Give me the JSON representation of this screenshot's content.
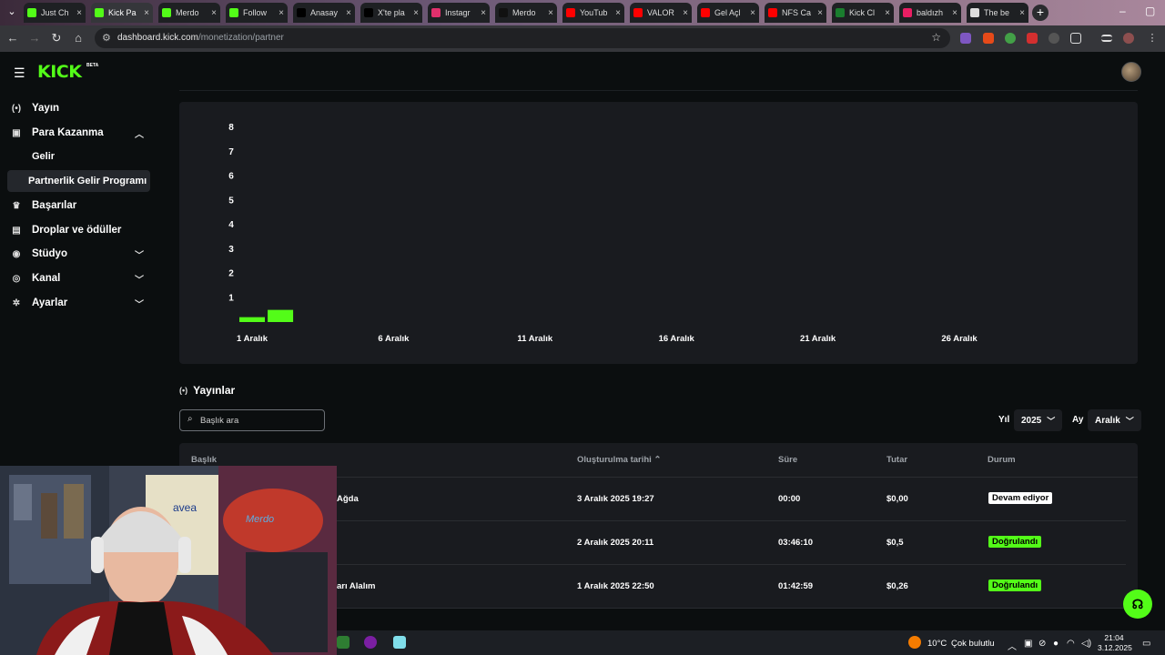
{
  "browser": {
    "tabs": [
      {
        "title": "Just Ch",
        "color": "#53fc18"
      },
      {
        "title": "Kick Pa",
        "color": "#53fc18",
        "active": true
      },
      {
        "title": "Merdo",
        "color": "#53fc18"
      },
      {
        "title": "Follow",
        "color": "#53fc18"
      },
      {
        "title": "Anasay",
        "color": "#000000"
      },
      {
        "title": "X'te pla",
        "color": "#000000"
      },
      {
        "title": "Instagr",
        "color": "#e1306c"
      },
      {
        "title": "Merdo",
        "color": "#111111"
      },
      {
        "title": "YouTub",
        "color": "#ff0000"
      },
      {
        "title": "VALOR",
        "color": "#ff0000"
      },
      {
        "title": "Gel Açl",
        "color": "#ff0000"
      },
      {
        "title": "NFS Ca",
        "color": "#ff0000"
      },
      {
        "title": "Kick Cl",
        "color": "#1a7d2e"
      },
      {
        "title": "baldızh",
        "color": "#e91e63"
      },
      {
        "title": "The be",
        "color": "#dddddd"
      }
    ],
    "url_host": "dashboard.kick.com",
    "url_path": "/monetization/partner"
  },
  "app": {
    "logo": "KICK",
    "logo_badge": "BETA"
  },
  "sidebar": {
    "items": [
      {
        "label": "Yayın",
        "icon": "broadcast-icon"
      },
      {
        "label": "Para Kazanma",
        "icon": "money-icon",
        "expanded": true
      },
      {
        "label": "Gelir",
        "sub": true
      },
      {
        "label": "Partnerlik Gelir Programı",
        "sub": true,
        "active": true
      },
      {
        "label": "Başarılar",
        "icon": "trophy-icon"
      },
      {
        "label": "Droplar ve ödüller",
        "icon": "gift-icon"
      },
      {
        "label": "Stüdyo",
        "icon": "studio-icon",
        "collapsible": true
      },
      {
        "label": "Kanal",
        "icon": "channel-icon",
        "collapsible": true
      },
      {
        "label": "Ayarlar",
        "icon": "gear-icon",
        "collapsible": true
      }
    ]
  },
  "chart_data": {
    "type": "bar",
    "categories": [
      "1 Aralık",
      "2 Aralık"
    ],
    "values": [
      0.2,
      0.5
    ],
    "x_ticks": [
      "1 Aralık",
      "6 Aralık",
      "11 Aralık",
      "16 Aralık",
      "21 Aralık",
      "26 Aralık"
    ],
    "y_ticks": [
      1,
      2,
      3,
      4,
      5,
      6,
      7,
      8
    ],
    "ylim": [
      0,
      8
    ],
    "bar_color": "#53fc18",
    "grid": false
  },
  "streams": {
    "title": "Yayınlar",
    "search_placeholder": "Başlık ara",
    "year_label": "Yıl",
    "year_value": "2025",
    "month_label": "Ay",
    "month_value": "Aralık",
    "columns": [
      "Başlık",
      "Oluşturulma tarihi",
      "Süre",
      "Tutar",
      "Durum"
    ],
    "rows": [
      {
        "title": "Ağda",
        "date": "3 Aralık 2025 19:27",
        "duration": "00:00",
        "amount": "$0,00",
        "status": "Devam ediyor",
        "status_kind": "live"
      },
      {
        "title": "",
        "date": "2 Aralık 2025 20:11",
        "duration": "03:46:10",
        "amount": "$0,5",
        "status": "Doğrulandı",
        "status_kind": "ok"
      },
      {
        "title": "arı Alalım",
        "date": "1 Aralık 2025 22:50",
        "duration": "01:42:59",
        "amount": "$0,26",
        "status": "Doğrulandı",
        "status_kind": "ok"
      }
    ]
  },
  "taskbar": {
    "temperature": "10°C",
    "weather": "Çok bulutlu",
    "time": "21:04",
    "date": "3.12.2025"
  }
}
